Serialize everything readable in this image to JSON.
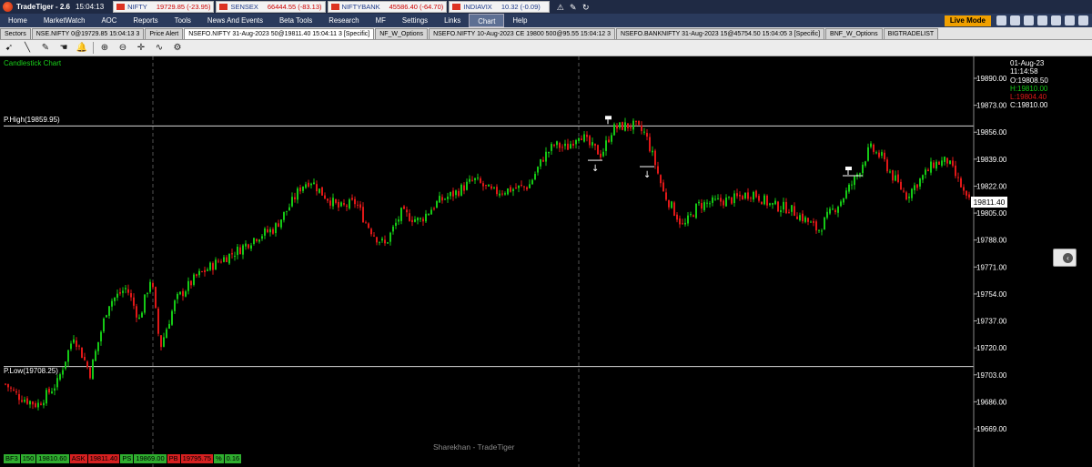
{
  "titlebar": {
    "app_title": "TradeTiger - 2.6",
    "time": "15:04:13",
    "tickers": [
      {
        "name": "NIFTY",
        "value": "19729.85 (-23.95)"
      },
      {
        "name": "SENSEX",
        "value": "66444.55 (-83.13)"
      },
      {
        "name": "NIFTYBANK",
        "value": "45586.40 (-64.70)"
      },
      {
        "name": "INDIAVIX",
        "value": "10.32 (-0.09)"
      }
    ]
  },
  "menu": {
    "items": [
      "Home",
      "MarketWatch",
      "AOC",
      "Reports",
      "Tools",
      "News And Events",
      "Beta Tools",
      "Research",
      "MF",
      "Settings",
      "Links",
      "Chart",
      "Help"
    ],
    "active": "Chart",
    "live_mode": "Live Mode"
  },
  "tabs": [
    "Sectors",
    "NSE.NIFTY 0@19729.85 15:04:13 3",
    "Price Alert",
    "NSEFO.NIFTY 31-Aug-2023 50@19811.40 15:04:11 3 [Specific]",
    "NF_W_Options",
    "NSEFO.NIFTY 10-Aug-2023 CE 19800 500@95.55 15:04:12 3",
    "NSEFO.BANKNIFTY 31-Aug-2023 15@45754.50 15:04:05 3 [Specific]",
    "BNF_W_Options",
    "BIGTRADELIST"
  ],
  "active_tab": 3,
  "toolbar": {
    "icons": [
      "cursor-icon",
      "line-icon",
      "pencil-icon",
      "hand-icon",
      "bell-icon",
      "zoom-in-icon",
      "zoom-out-icon",
      "crosshair-icon",
      "indicator-icon",
      "settings-icon"
    ]
  },
  "chart": {
    "title": "Candlestick Chart",
    "prev_high_label": "P.High(19859.95)",
    "prev_low_label": "P.Low(19708.25)",
    "watermark": "Sharekhan - TradeTiger",
    "current_price": "19811.40",
    "info": {
      "date": "01-Aug-23",
      "time": "11:14:58",
      "open": "O:19808.50",
      "high": "H:19810.00",
      "low": "L:19804.40",
      "close": "C:19810.00"
    },
    "colors": {
      "up": "#15c815",
      "down": "#e01818",
      "background": "#000000",
      "axis_text": "#ffffff"
    }
  },
  "chart_data": {
    "type": "candlestick",
    "title": "Candlestick Chart",
    "yticks": [
      19890.0,
      19873.0,
      19856.0,
      19839.0,
      19822.0,
      19805.0,
      19788.0,
      19771.0,
      19754.0,
      19737.0,
      19720.0,
      19703.0,
      19686.0,
      19669.0
    ],
    "yticks_display": [
      "19890.00",
      "19873.00",
      "19856.00",
      "19839.00",
      "19822.00",
      "19805.00",
      "19788.00",
      "19771.00",
      "19754.00",
      "19737.00",
      "19720.00",
      "19703.00",
      "19686.00",
      "19669.00"
    ],
    "ylim": [
      19660,
      19905
    ],
    "reference_lines": [
      {
        "label": "P.High(19859.95)",
        "value": 19859.95
      },
      {
        "label": "P.Low(19708.25)",
        "value": 19708.25
      }
    ],
    "close_path": [
      [
        0,
        19700
      ],
      [
        18,
        19690
      ],
      [
        40,
        19684
      ],
      [
        62,
        19698
      ],
      [
        80,
        19728
      ],
      [
        98,
        19704
      ],
      [
        118,
        19748
      ],
      [
        138,
        19758
      ],
      [
        152,
        19738
      ],
      [
        165,
        19765
      ],
      [
        175,
        19720
      ],
      [
        192,
        19750
      ],
      [
        215,
        19765
      ],
      [
        240,
        19775
      ],
      [
        262,
        19782
      ],
      [
        280,
        19790
      ],
      [
        300,
        19795
      ],
      [
        318,
        19810
      ],
      [
        330,
        19822
      ],
      [
        340,
        19826
      ],
      [
        352,
        19818
      ],
      [
        372,
        19808
      ],
      [
        390,
        19812
      ],
      [
        400,
        19800
      ],
      [
        412,
        19790
      ],
      [
        422,
        19785
      ],
      [
        440,
        19805
      ],
      [
        460,
        19800
      ],
      [
        480,
        19812
      ],
      [
        500,
        19818
      ],
      [
        520,
        19826
      ],
      [
        540,
        19818
      ],
      [
        560,
        19820
      ],
      [
        580,
        19822
      ],
      [
        596,
        19840
      ],
      [
        608,
        19848
      ],
      [
        622,
        19846
      ],
      [
        636,
        19856
      ],
      [
        646,
        19848
      ],
      [
        660,
        19842
      ],
      [
        672,
        19858
      ],
      [
        684,
        19860
      ],
      [
        696,
        19860
      ],
      [
        708,
        19855
      ],
      [
        718,
        19838
      ],
      [
        728,
        19818
      ],
      [
        738,
        19808
      ],
      [
        750,
        19796
      ],
      [
        766,
        19810
      ],
      [
        786,
        19812
      ],
      [
        806,
        19814
      ],
      [
        826,
        19818
      ],
      [
        846,
        19810
      ],
      [
        866,
        19808
      ],
      [
        886,
        19800
      ],
      [
        898,
        19794
      ],
      [
        910,
        19804
      ],
      [
        922,
        19812
      ],
      [
        938,
        19826
      ],
      [
        955,
        19846
      ],
      [
        968,
        19840
      ],
      [
        980,
        19828
      ],
      [
        995,
        19816
      ],
      [
        1010,
        19826
      ],
      [
        1025,
        19836
      ],
      [
        1040,
        19838
      ],
      [
        1055,
        19822
      ],
      [
        1062,
        19812
      ]
    ],
    "annotations": [
      {
        "type": "down-arrow",
        "value": 19836
      },
      {
        "type": "down-arrow",
        "value": 19832
      },
      {
        "type": "marker-flag",
        "value": 19864
      },
      {
        "type": "marker-flag",
        "value": 19832
      }
    ]
  },
  "bottom_strip": [
    {
      "text": "BF3",
      "bg": "#2fae2f"
    },
    {
      "text": "150",
      "bg": "#2fae2f"
    },
    {
      "text": "19810.60",
      "bg": "#2fae2f"
    },
    {
      "text": "ASK",
      "bg": "#d62020"
    },
    {
      "text": "19811.40",
      "bg": "#d62020"
    },
    {
      "text": "PS",
      "bg": "#2fae2f"
    },
    {
      "text": "19869.00",
      "bg": "#2fae2f"
    },
    {
      "text": "PB",
      "bg": "#d62020"
    },
    {
      "text": "19795.75",
      "bg": "#d62020"
    },
    {
      "text": "%",
      "bg": "#2fae2f"
    },
    {
      "text": "0.16",
      "bg": "#2fae2f"
    }
  ]
}
